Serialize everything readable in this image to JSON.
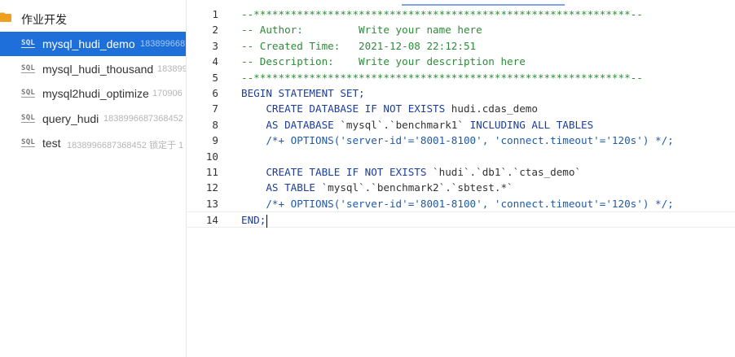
{
  "sidebar": {
    "folder": "作业开发",
    "jobs": [
      {
        "name": "mysql_hudi_demo",
        "meta": "183899668",
        "selected": true
      },
      {
        "name": "mysql_hudi_thousand",
        "meta": "183899",
        "selected": false
      },
      {
        "name": "mysql2hudi_optimize",
        "meta": "170906",
        "selected": false
      },
      {
        "name": "query_hudi",
        "meta": "1838996687368452",
        "selected": false
      },
      {
        "name": "test",
        "meta": "1838996687368452 锁定于 1",
        "selected": false
      }
    ],
    "sql_icon_label": "SQL"
  },
  "editor": {
    "active_line": 14,
    "lines": [
      {
        "num": "1",
        "segs": [
          {
            "t": "--*************************************************************--",
            "c": "com"
          }
        ]
      },
      {
        "num": "2",
        "segs": [
          {
            "t": "-- Author:         Write your name here",
            "c": "com"
          }
        ]
      },
      {
        "num": "3",
        "segs": [
          {
            "t": "-- Created Time:   2021-12-08 22:12:51",
            "c": "com"
          }
        ]
      },
      {
        "num": "4",
        "segs": [
          {
            "t": "-- Description:    Write your description here",
            "c": "com"
          }
        ]
      },
      {
        "num": "5",
        "segs": [
          {
            "t": "--*************************************************************--",
            "c": "com"
          }
        ]
      },
      {
        "num": "6",
        "segs": [
          {
            "t": "BEGIN STATEMENT SET;",
            "c": "kw"
          }
        ]
      },
      {
        "num": "7",
        "segs": [
          {
            "t": "    CREATE DATABASE IF NOT EXISTS ",
            "c": "kw"
          },
          {
            "t": "hudi.cdas_demo",
            "c": "id"
          }
        ]
      },
      {
        "num": "8",
        "segs": [
          {
            "t": "    AS DATABASE ",
            "c": "kw"
          },
          {
            "t": "`mysql`.`benchmark1`",
            "c": "id"
          },
          {
            "t": " INCLUDING ALL TABLES",
            "c": "kw"
          }
        ]
      },
      {
        "num": "9",
        "segs": [
          {
            "t": "    /*+ OPTIONS('server-id'='8001-8100', 'connect.timeout'='120s') */;",
            "c": "hint"
          }
        ]
      },
      {
        "num": "10",
        "segs": []
      },
      {
        "num": "11",
        "segs": [
          {
            "t": "    CREATE TABLE IF NOT EXISTS ",
            "c": "kw"
          },
          {
            "t": "`hudi`.`db1`.`ctas_demo`",
            "c": "id"
          }
        ]
      },
      {
        "num": "12",
        "segs": [
          {
            "t": "    AS TABLE ",
            "c": "kw"
          },
          {
            "t": "`mysql`.`benchmark2`.`sbtest.*`",
            "c": "id"
          }
        ]
      },
      {
        "num": "13",
        "segs": [
          {
            "t": "    /*+ OPTIONS('server-id'='8001-8100', 'connect.timeout'='120s') */;",
            "c": "hint"
          }
        ]
      },
      {
        "num": "14",
        "segs": [
          {
            "t": "END;",
            "c": "kw"
          }
        ]
      }
    ]
  },
  "colors": {
    "selection": "#1e6fd9",
    "folder": "#f0a020",
    "comment": "#2e8b3a",
    "keyword": "#1a3d9e"
  }
}
